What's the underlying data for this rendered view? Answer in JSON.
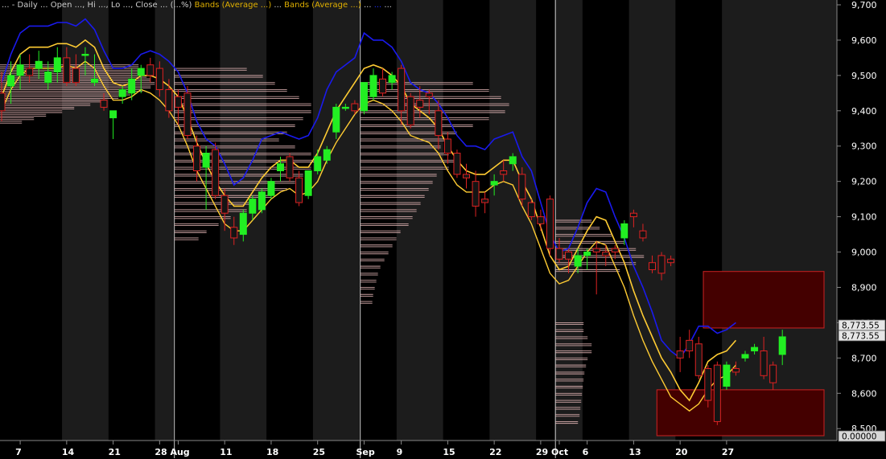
{
  "header": {
    "segments": [
      {
        "text": "... - Daily ... Open ..., Hi ..., Lo ..., Close ... (...%)",
        "color": "#cccccc"
      },
      {
        "text": "Bands (Average ...)",
        "color": "#e0b000"
      },
      {
        "text": "...",
        "color": "#cccccc"
      },
      {
        "text": "Bands (Average ...)",
        "color": "#e0b000"
      },
      {
        "text": "...",
        "color": "#cccccc"
      },
      {
        "text": "...",
        "color": "#2233ff"
      },
      {
        "text": "...",
        "color": "#cccccc"
      }
    ]
  },
  "price_labels": [
    {
      "text": "8,773.55",
      "value": 8773.55
    },
    {
      "text": "8,773.55",
      "value": 8773.55
    },
    {
      "text": "0.00000",
      "value": 8525
    }
  ],
  "colors": {
    "background": "#000000",
    "alt_band": "#1c1c1c",
    "up_candle": "#22ee22",
    "down_candle": "#141414",
    "down_outline": "#dd2222",
    "upper_band": "#1a1aee",
    "mid_band": "#ffcc33",
    "volume_profile": "#f0c0c0",
    "box_fill": "#440000",
    "box_edge": "#cc2222",
    "axis_text": "#ffffff",
    "month_line": "#c8c8c8"
  },
  "chart_data": {
    "type": "candlestick",
    "ylim": [
      8480,
      9700
    ],
    "y_ticks": [
      {
        "value": 8500,
        "label": "8,500"
      },
      {
        "value": 8600,
        "label": "8,600"
      },
      {
        "value": 8700,
        "label": "8,700"
      },
      {
        "value": 8800,
        "label": "8,800"
      },
      {
        "value": 8900,
        "label": "8,900"
      },
      {
        "value": 9000,
        "label": "9,000"
      },
      {
        "value": 9100,
        "label": "9,100"
      },
      {
        "value": 9200,
        "label": "9,200"
      },
      {
        "value": 9300,
        "label": "9,300"
      },
      {
        "value": 9400,
        "label": "9,400"
      },
      {
        "value": 9500,
        "label": "9,500"
      },
      {
        "value": 9600,
        "label": "9,600"
      },
      {
        "value": 9700,
        "label": "9,700"
      }
    ],
    "x_ticks": [
      {
        "index": 2,
        "label": "7"
      },
      {
        "index": 7,
        "label": "14"
      },
      {
        "index": 12,
        "label": "21"
      },
      {
        "index": 17,
        "label": "28"
      },
      {
        "index": 19,
        "label": "Aug",
        "month_start": true
      },
      {
        "index": 24,
        "label": "11"
      },
      {
        "index": 29,
        "label": "18"
      },
      {
        "index": 34,
        "label": "25"
      },
      {
        "index": 39,
        "label": "Sep",
        "month_start": true
      },
      {
        "index": 43,
        "label": "9"
      },
      {
        "index": 48,
        "label": "15"
      },
      {
        "index": 53,
        "label": "22"
      },
      {
        "index": 58,
        "label": "29"
      },
      {
        "index": 60,
        "label": "Oct",
        "month_start": true
      },
      {
        "index": 63,
        "label": "6"
      },
      {
        "index": 68,
        "label": "13"
      },
      {
        "index": 73,
        "label": "20"
      },
      {
        "index": 78,
        "label": "27"
      }
    ],
    "candles": [
      [
        9450,
        9510,
        9370,
        9400
      ],
      [
        9470,
        9540,
        9420,
        9500
      ],
      [
        9500,
        9560,
        9460,
        9530
      ],
      [
        9520,
        9560,
        9480,
        9500
      ],
      [
        9520,
        9570,
        9490,
        9540
      ],
      [
        9480,
        9540,
        9460,
        9510
      ],
      [
        9510,
        9580,
        9480,
        9550
      ],
      [
        9550,
        9580,
        9470,
        9480
      ],
      [
        9520,
        9560,
        9470,
        9480
      ],
      [
        9560,
        9580,
        9500,
        9560
      ],
      [
        9480,
        9560,
        9470,
        9490
      ],
      [
        9430,
        9450,
        9400,
        9410
      ],
      [
        9380,
        9400,
        9320,
        9400
      ],
      [
        9440,
        9470,
        9420,
        9460
      ],
      [
        9450,
        9520,
        9430,
        9490
      ],
      [
        9500,
        9530,
        9450,
        9520
      ],
      [
        9530,
        9550,
        9480,
        9500
      ],
      [
        9520,
        9540,
        9440,
        9460
      ],
      [
        9460,
        9490,
        9380,
        9400
      ],
      [
        9440,
        9460,
        9360,
        9410
      ],
      [
        9450,
        9470,
        9320,
        9330
      ],
      [
        9300,
        9330,
        9200,
        9230
      ],
      [
        9240,
        9300,
        9120,
        9280
      ],
      [
        9290,
        9310,
        9150,
        9160
      ],
      [
        9160,
        9180,
        9060,
        9110
      ],
      [
        9070,
        9100,
        9020,
        9040
      ],
      [
        9050,
        9120,
        9030,
        9110
      ],
      [
        9110,
        9160,
        9090,
        9150
      ],
      [
        9120,
        9180,
        9110,
        9170
      ],
      [
        9160,
        9210,
        9150,
        9200
      ],
      [
        9230,
        9270,
        9200,
        9250
      ],
      [
        9270,
        9280,
        9200,
        9210
      ],
      [
        9210,
        9230,
        9130,
        9140
      ],
      [
        9160,
        9230,
        9150,
        9230
      ],
      [
        9230,
        9290,
        9220,
        9270
      ],
      [
        9260,
        9300,
        9250,
        9290
      ],
      [
        9340,
        9420,
        9320,
        9410
      ],
      [
        9410,
        9420,
        9400,
        9410
      ],
      [
        9420,
        9430,
        9390,
        9400
      ],
      [
        9400,
        9480,
        9390,
        9480
      ],
      [
        9440,
        9520,
        9430,
        9500
      ],
      [
        9490,
        9520,
        9440,
        9450
      ],
      [
        9480,
        9510,
        9460,
        9500
      ],
      [
        9520,
        9530,
        9360,
        9400
      ],
      [
        9440,
        9450,
        9350,
        9360
      ],
      [
        9430,
        9470,
        9380,
        9410
      ],
      [
        9450,
        9460,
        9390,
        9440
      ],
      [
        9400,
        9430,
        9290,
        9330
      ],
      [
        9320,
        9340,
        9250,
        9280
      ],
      [
        9280,
        9290,
        9210,
        9220
      ],
      [
        9220,
        9250,
        9180,
        9210
      ],
      [
        9200,
        9230,
        9100,
        9130
      ],
      [
        9150,
        9170,
        9110,
        9140
      ],
      [
        9190,
        9220,
        9160,
        9200
      ],
      [
        9230,
        9260,
        9200,
        9220
      ],
      [
        9250,
        9280,
        9230,
        9270
      ],
      [
        9220,
        9240,
        9130,
        9150
      ],
      [
        9140,
        9150,
        9090,
        9100
      ],
      [
        9100,
        9120,
        9060,
        9080
      ],
      [
        9150,
        9160,
        8990,
        9010
      ],
      [
        9010,
        9040,
        8970,
        8980
      ],
      [
        9000,
        9010,
        8940,
        8980
      ],
      [
        8960,
        9010,
        8940,
        8990
      ],
      [
        8990,
        9010,
        8950,
        9000
      ],
      [
        9010,
        9030,
        8880,
        9000
      ],
      [
        9000,
        9020,
        8960,
        8990
      ],
      [
        9010,
        9020,
        8980,
        9000
      ],
      [
        9040,
        9090,
        9020,
        9080
      ],
      [
        9110,
        9120,
        9070,
        9100
      ],
      [
        9060,
        9080,
        9030,
        9040
      ],
      [
        8970,
        8990,
        8940,
        8950
      ],
      [
        8990,
        9000,
        8920,
        8940
      ],
      [
        8980,
        8990,
        8960,
        8970
      ],
      [
        8720,
        8760,
        8660,
        8700
      ],
      [
        8750,
        8780,
        8700,
        8720
      ],
      [
        8740,
        8760,
        8640,
        8650
      ],
      [
        8670,
        8680,
        8560,
        8580
      ],
      [
        8680,
        8690,
        8510,
        8520
      ],
      [
        8620,
        8690,
        8610,
        8680
      ],
      [
        8670,
        8690,
        8650,
        8660
      ],
      [
        8700,
        8720,
        8690,
        8710
      ],
      [
        8720,
        8740,
        8710,
        8730
      ],
      [
        8720,
        8760,
        8640,
        8650
      ],
      [
        8680,
        8690,
        8610,
        8630
      ],
      [
        8710,
        8780,
        8680,
        8760
      ]
    ],
    "upper_band": [
      9480,
      9560,
      9620,
      9640,
      9640,
      9640,
      9650,
      9650,
      9640,
      9660,
      9630,
      9570,
      9520,
      9520,
      9530,
      9560,
      9570,
      9560,
      9540,
      9510,
      9450,
      9370,
      9320,
      9300,
      9250,
      9190,
      9210,
      9260,
      9320,
      9330,
      9340,
      9330,
      9320,
      9330,
      9380,
      9460,
      9510,
      9530,
      9550,
      9620,
      9600,
      9600,
      9580,
      9540,
      9480,
      9460,
      9450,
      9420,
      9380,
      9330,
      9300,
      9300,
      9290,
      9320,
      9330,
      9340,
      9270,
      9230,
      9140,
      9050,
      9000,
      9010,
      9070,
      9140,
      9180,
      9170,
      9100,
      9040,
      8960,
      8900,
      8830,
      8750,
      8720,
      8700,
      8740,
      8790,
      8790,
      8770,
      8780,
      8800
    ],
    "mid_band": [
      9440,
      9510,
      9560,
      9580,
      9580,
      9580,
      9590,
      9590,
      9580,
      9600,
      9580,
      9520,
      9480,
      9470,
      9480,
      9500,
      9500,
      9490,
      9470,
      9440,
      9380,
      9310,
      9250,
      9200,
      9160,
      9130,
      9130,
      9170,
      9210,
      9240,
      9260,
      9260,
      9240,
      9240,
      9280,
      9340,
      9400,
      9440,
      9480,
      9520,
      9530,
      9520,
      9500,
      9470,
      9420,
      9400,
      9380,
      9350,
      9300,
      9260,
      9230,
      9220,
      9220,
      9240,
      9260,
      9260,
      9200,
      9150,
      9070,
      8990,
      8950,
      8960,
      9010,
      9060,
      9100,
      9090,
      9030,
      8970,
      8890,
      8820,
      8760,
      8700,
      8660,
      8610,
      8580,
      8630,
      8690,
      8710,
      8720,
      8750
    ],
    "lower_band": [
      9400,
      9460,
      9500,
      9520,
      9520,
      9520,
      9520,
      9530,
      9520,
      9540,
      9520,
      9470,
      9430,
      9430,
      9440,
      9460,
      9450,
      9430,
      9400,
      9360,
      9300,
      9230,
      9180,
      9130,
      9080,
      9060,
      9060,
      9090,
      9120,
      9150,
      9170,
      9180,
      9160,
      9170,
      9200,
      9260,
      9310,
      9350,
      9390,
      9420,
      9430,
      9420,
      9400,
      9370,
      9330,
      9320,
      9310,
      9280,
      9230,
      9190,
      9170,
      9170,
      9170,
      9190,
      9200,
      9190,
      9130,
      9080,
      9010,
      8940,
      8910,
      8920,
      8960,
      9000,
      9030,
      9020,
      8960,
      8900,
      8820,
      8750,
      8690,
      8640,
      8590,
      8570,
      8550,
      8570,
      8610,
      8640,
      8650,
      8680
    ],
    "volume_profiles": [
      {
        "start": 0,
        "end": 18,
        "bins": [
          [
            9530,
            175
          ],
          [
            9520,
            175
          ],
          [
            9510,
            180
          ],
          [
            9500,
            185
          ],
          [
            9490,
            190
          ],
          [
            9480,
            195
          ],
          [
            9470,
            190
          ],
          [
            9460,
            180
          ],
          [
            9450,
            165
          ],
          [
            9440,
            150
          ],
          [
            9430,
            135
          ],
          [
            9420,
            115
          ],
          [
            9410,
            95
          ],
          [
            9400,
            80
          ],
          [
            9390,
            60
          ],
          [
            9380,
            45
          ],
          [
            9370,
            30
          ]
        ]
      },
      {
        "start": 19,
        "end": 38,
        "bins": [
          [
            9520,
            90
          ],
          [
            9500,
            110
          ],
          [
            9480,
            125
          ],
          [
            9460,
            140
          ],
          [
            9440,
            155
          ],
          [
            9420,
            170
          ],
          [
            9400,
            170
          ],
          [
            9380,
            160
          ],
          [
            9360,
            150
          ],
          [
            9340,
            140
          ],
          [
            9320,
            130
          ],
          [
            9300,
            150
          ],
          [
            9280,
            170
          ],
          [
            9260,
            180
          ],
          [
            9240,
            170
          ],
          [
            9220,
            160
          ],
          [
            9200,
            150
          ],
          [
            9180,
            140
          ],
          [
            9160,
            120
          ],
          [
            9140,
            100
          ],
          [
            9120,
            90
          ],
          [
            9100,
            70
          ],
          [
            9080,
            55
          ],
          [
            9060,
            40
          ],
          [
            9040,
            30
          ]
        ]
      },
      {
        "start": 39,
        "end": 58,
        "bins": [
          [
            9480,
            140
          ],
          [
            9460,
            160
          ],
          [
            9440,
            175
          ],
          [
            9420,
            185
          ],
          [
            9400,
            180
          ],
          [
            9380,
            160
          ],
          [
            9360,
            140
          ],
          [
            9340,
            120
          ],
          [
            9320,
            110
          ],
          [
            9300,
            100
          ],
          [
            9280,
            110
          ],
          [
            9260,
            120
          ],
          [
            9240,
            110
          ],
          [
            9220,
            95
          ],
          [
            9200,
            90
          ],
          [
            9180,
            85
          ],
          [
            9160,
            80
          ],
          [
            9140,
            75
          ],
          [
            9120,
            70
          ],
          [
            9100,
            65
          ],
          [
            9080,
            60
          ],
          [
            9060,
            50
          ],
          [
            9040,
            45
          ],
          [
            9020,
            40
          ],
          [
            9000,
            35
          ],
          [
            8980,
            30
          ],
          [
            8960,
            25
          ],
          [
            8940,
            22
          ],
          [
            8920,
            20
          ],
          [
            8900,
            18
          ],
          [
            8880,
            16
          ],
          [
            8860,
            15
          ]
        ]
      },
      {
        "start": 60,
        "end": 80,
        "bins": [
          [
            9090,
            45
          ],
          [
            9070,
            55
          ],
          [
            9050,
            70
          ],
          [
            9030,
            85
          ],
          [
            9010,
            100
          ],
          [
            8990,
            110
          ],
          [
            8970,
            100
          ],
          [
            8950,
            80
          ],
          [
            8800,
            35
          ],
          [
            8780,
            35
          ],
          [
            8760,
            40
          ],
          [
            8740,
            45
          ],
          [
            8720,
            45
          ],
          [
            8700,
            40
          ],
          [
            8680,
            38
          ],
          [
            8660,
            36
          ],
          [
            8640,
            35
          ],
          [
            8620,
            34
          ],
          [
            8600,
            33
          ],
          [
            8580,
            32
          ],
          [
            8560,
            31
          ],
          [
            8540,
            30
          ],
          [
            8520,
            28
          ]
        ]
      }
    ],
    "boxes": [
      {
        "index_start": 76,
        "y_top": 8945,
        "y_bottom": 8785
      },
      {
        "index_start": 71,
        "y_top": 8610,
        "y_bottom": 8480
      }
    ]
  }
}
